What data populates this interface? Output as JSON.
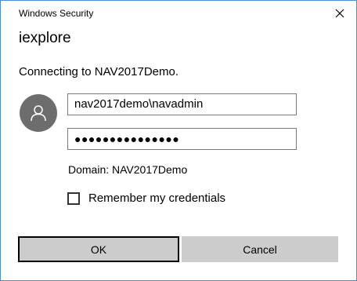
{
  "window": {
    "title": "Windows Security"
  },
  "dialog": {
    "app_name": "iexplore",
    "message": "Connecting to NAV2017Demo.",
    "username_value": "nav2017demo\\navadmin",
    "password_masked": "●●●●●●●●●●●●●●●",
    "domain_text": "Domain: NAV2017Demo",
    "remember_label": "Remember my credentials",
    "remember_checked": false
  },
  "buttons": {
    "ok_label": "OK",
    "cancel_label": "Cancel"
  },
  "icons": {
    "close": "close-icon",
    "avatar": "user-icon"
  },
  "colors": {
    "window_border": "#4a8fd6",
    "avatar_bg": "#6d6d6d",
    "button_bg": "#cccccc"
  }
}
